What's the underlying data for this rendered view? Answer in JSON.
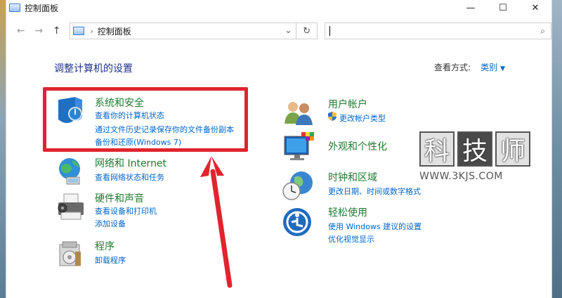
{
  "window": {
    "title": "控制面板",
    "controls": {
      "minimize": "—",
      "maximize": "☐",
      "close": "✕"
    }
  },
  "nav": {
    "back": "←",
    "forward": "→",
    "up": "↑",
    "breadcrumb_sep": "›",
    "breadcrumb": "控制面板",
    "dropdown": "⌄",
    "refresh": "↻",
    "search_placeholder": "",
    "search_icon": "⌕"
  },
  "content": {
    "heading": "调整计算机的设置",
    "view_by_label": "查看方式:",
    "view_by_value": "类别",
    "view_by_arrow": "▼"
  },
  "categories_left": [
    {
      "title": "系统和安全",
      "links": [
        "查看你的计算机状态",
        "通过文件历史记录保存你的文件备份副本",
        "备份和还原(Windows 7)"
      ],
      "icon": "shield-icon"
    },
    {
      "title": "网络和 Internet",
      "links": [
        "查看网络状态和任务"
      ],
      "icon": "network-icon"
    },
    {
      "title": "硬件和声音",
      "links": [
        "查看设备和打印机",
        "添加设备"
      ],
      "icon": "printer-icon"
    },
    {
      "title": "程序",
      "links": [
        "卸载程序"
      ],
      "icon": "programs-icon"
    }
  ],
  "categories_right": [
    {
      "title": "用户帐户",
      "links": [
        "更改帐户类型"
      ],
      "icon": "users-icon"
    },
    {
      "title": "外观和个性化",
      "links": [],
      "icon": "monitor-palette-icon"
    },
    {
      "title": "时钟和区域",
      "links": [
        "更改日期、时间或数字格式"
      ],
      "icon": "clock-globe-icon"
    },
    {
      "title": "轻松使用",
      "links": [
        "使用 Windows 建议的设置",
        "优化视觉显示"
      ],
      "icon": "accessibility-icon"
    }
  ],
  "watermark": {
    "chars": [
      "科",
      "技",
      "师"
    ],
    "url": "WWW.3KJS.COM"
  },
  "colors": {
    "category_title": "#1e7a2e",
    "link": "#0066cc",
    "heading": "#1e3287",
    "annotation_red": "#e0242e"
  }
}
